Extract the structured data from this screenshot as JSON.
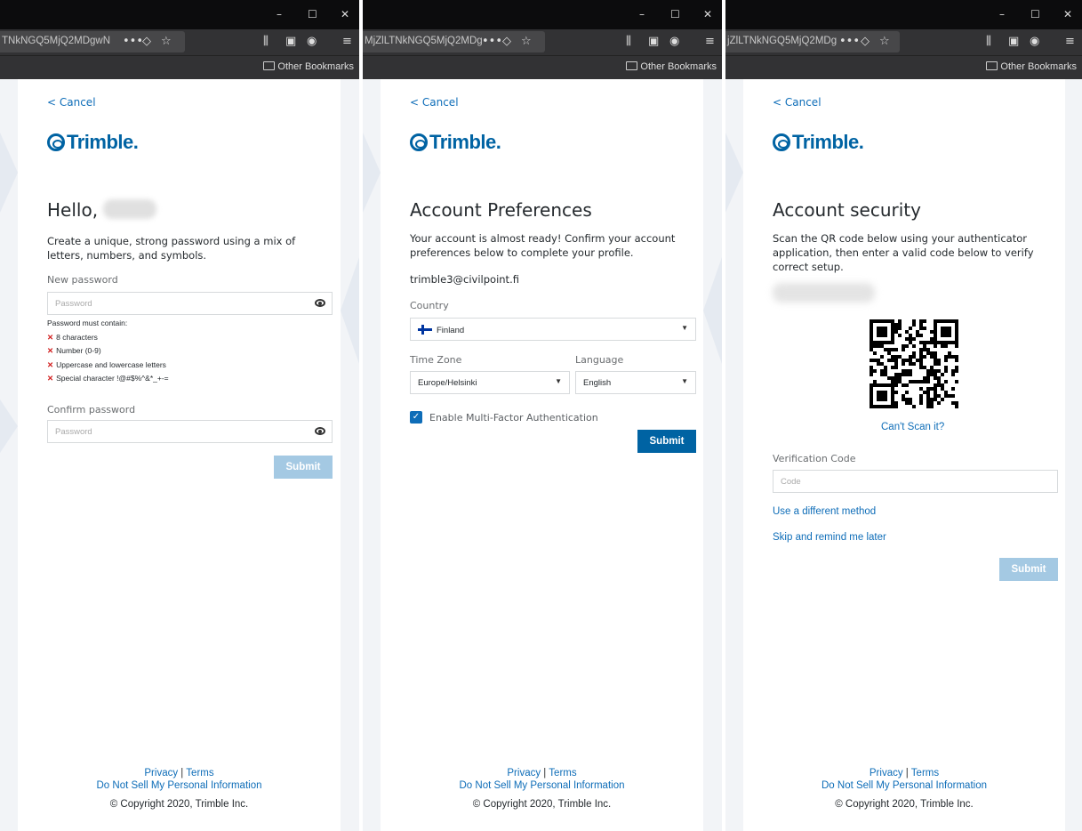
{
  "browser": {
    "panels": [
      {
        "url_fragment": "TNkNGQ5MjQ2MDgwN",
        "bookmarks": "Other Bookmarks"
      },
      {
        "url_fragment": "MjZlLTNkNGQ5MjQ2MDg",
        "bookmarks": "Other Bookmarks"
      },
      {
        "url_fragment": "jZlLTNkNGQ5MjQ2MDg",
        "bookmarks": "Other Bookmarks"
      }
    ],
    "window_controls": [
      "–",
      "☐",
      "✕"
    ]
  },
  "common": {
    "cancel": "< Cancel",
    "brand": "Trimble.",
    "privacy": "Privacy",
    "sep": "|",
    "terms": "Terms",
    "dnsmpi": "Do Not Sell My Personal Information",
    "copyright": "© Copyright 2020, Trimble Inc."
  },
  "password_page": {
    "greeting": "Hello,",
    "intro": "Create a unique, strong password using a mix of letters, numbers, and symbols.",
    "new_label": "New password",
    "new_placeholder": "Password",
    "rules_title": "Password must contain:",
    "rules": [
      "8 characters",
      "Number (0-9)",
      "Uppercase and lowercase letters",
      "Special character !@#$%^&*_+-="
    ],
    "confirm_label": "Confirm password",
    "confirm_placeholder": "Password",
    "submit": "Submit"
  },
  "preferences_page": {
    "title": "Account Preferences",
    "intro": "Your account is almost ready! Confirm your account preferences below to complete your profile.",
    "email": "trimble3@civilpoint.fi",
    "country_label": "Country",
    "country": "Finland",
    "timezone_label": "Time Zone",
    "timezone": "Europe/Helsinki",
    "language_label": "Language",
    "language": "English",
    "mfa_label": "Enable Multi-Factor Authentication",
    "mfa_checked": true,
    "submit": "Submit"
  },
  "security_page": {
    "title": "Account security",
    "intro": "Scan the QR code below using your authenticator application, then enter a valid code below to verify correct setup.",
    "cant_scan": "Can't Scan it?",
    "code_label": "Verification Code",
    "code_placeholder": "Code",
    "different_method": "Use a different method",
    "skip": "Skip and remind me later",
    "submit": "Submit"
  }
}
